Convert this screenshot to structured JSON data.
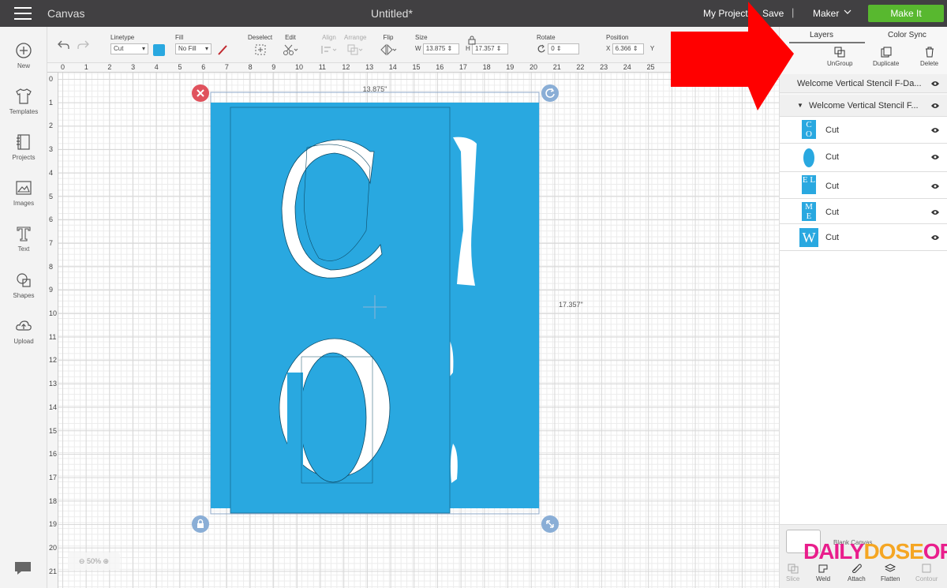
{
  "topbar": {
    "app_title": "Canvas",
    "doc_title": "Untitled*",
    "my_projects": "My Projects",
    "save": "Save",
    "separator": "|",
    "machine": "Maker",
    "make_it": "Make It",
    "make_it_color": "#58b82f"
  },
  "leftbar": {
    "items": [
      {
        "label": "New",
        "icon": "plus-circle-icon"
      },
      {
        "label": "Templates",
        "icon": "tshirt-icon"
      },
      {
        "label": "Projects",
        "icon": "notebook-icon"
      },
      {
        "label": "Images",
        "icon": "image-icon"
      },
      {
        "label": "Text",
        "icon": "text-t-icon"
      },
      {
        "label": "Shapes",
        "icon": "shapes-icon"
      },
      {
        "label": "Upload",
        "icon": "cloud-upload-icon"
      }
    ]
  },
  "toolbar": {
    "linetype_label": "Linetype",
    "linetype_value": "Cut",
    "fill_label": "Fill",
    "fill_value": "No Fill",
    "swatch_color": "#29a8e0",
    "deselect_label": "Deselect",
    "edit_label": "Edit",
    "align_label": "Align",
    "arrange_label": "Arrange",
    "flip_label": "Flip",
    "size_label": "Size",
    "w_label": "W",
    "w_value": "13.875",
    "h_label": "H",
    "h_value": "17.357",
    "rotate_label": "Rotate",
    "rotate_value": "0",
    "position_label": "Position",
    "x_label": "X",
    "x_value": "6.366",
    "y_label": "Y"
  },
  "ruler": {
    "h_ticks": [
      "0",
      "1",
      "2",
      "3",
      "4",
      "5",
      "6",
      "7",
      "8",
      "9",
      "10",
      "11",
      "12",
      "13",
      "14",
      "15",
      "16",
      "17",
      "18",
      "19",
      "20",
      "21",
      "22",
      "23",
      "24",
      "25"
    ],
    "v_ticks": [
      "0",
      "1",
      "2",
      "3",
      "4",
      "5",
      "6",
      "7",
      "8",
      "9",
      "10",
      "11",
      "12",
      "13",
      "14",
      "15",
      "16",
      "17",
      "18",
      "19",
      "20",
      "21"
    ]
  },
  "canvas": {
    "width_label": "13.875\"",
    "height_label": "17.357\"",
    "shape_color": "#29a8e0",
    "letters_front": [
      "C",
      "O"
    ],
    "zoom": "50%"
  },
  "panel": {
    "tab_layers": "Layers",
    "tab_color_sync": "Color Sync",
    "ungroup": "UnGroup",
    "duplicate": "Duplicate",
    "delete": "Delete",
    "layer_top": "Welcome Vertical Stencil F-Da...",
    "layer_group": "Welcome Vertical Stencil F...",
    "sublayers": [
      {
        "thumb": "C O",
        "label": "Cut"
      },
      {
        "thumb": "",
        "label": "Cut"
      },
      {
        "thumb": "E L",
        "label": "Cut"
      },
      {
        "thumb": "M E",
        "label": "Cut"
      },
      {
        "thumb": "W",
        "label": "Cut"
      }
    ],
    "blank_canvas": "Blank Canvas",
    "bottom_tools": [
      "Slice",
      "Weld",
      "Attach",
      "Flatten",
      "Contour"
    ]
  },
  "watermark": {
    "part1": "DAILY",
    "part2": "DOSE",
    "part3": "OF",
    "color1": "#e91e8c",
    "color2": "#f5a623"
  }
}
